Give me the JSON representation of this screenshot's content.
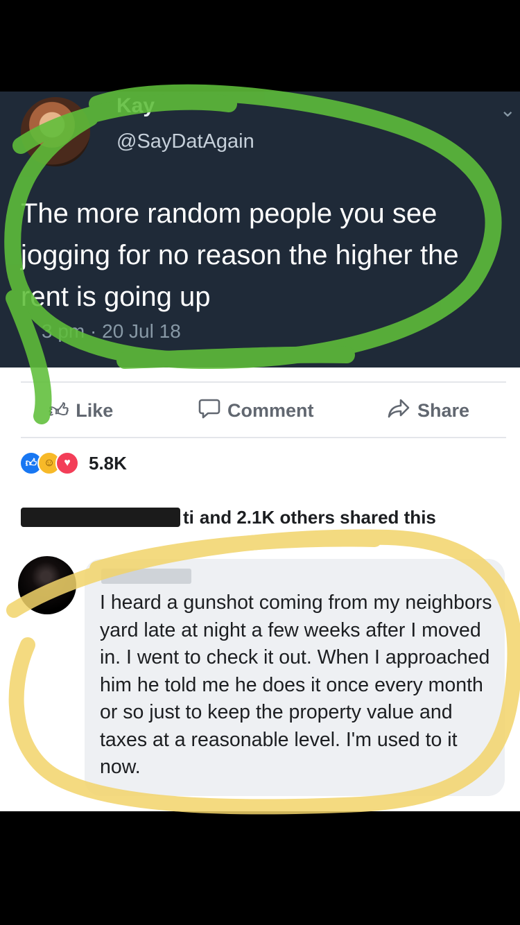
{
  "tweet": {
    "name": "Kay",
    "handle": "@SayDatAgain",
    "text": "The more random people you see jogging for no reason the higher the rent is going up",
    "time": "3 pm · 20 Jul 18",
    "chevron_icon": "chevron-down-icon"
  },
  "facebook": {
    "actions": {
      "like_label": "Like",
      "comment_label": "Comment",
      "share_label": "Share"
    },
    "reactions": {
      "icons": [
        "like-reaction-icon",
        "haha-reaction-icon",
        "love-reaction-icon"
      ],
      "count": "5.8K"
    },
    "shared": {
      "visible_name_fragment": "ti",
      "text": "and 2.1K others shared this"
    },
    "comment": {
      "text": "I heard a gunshot coming from my neighbors yard late at night a few weeks after I moved in. I went to check it out. When I approached him he told me he does it once every month or so just to keep the property value and taxes at a reasonable level. I'm used to it now."
    }
  },
  "highlights": {
    "green": "#5fbf3a",
    "yellow": "#f2d46a"
  }
}
